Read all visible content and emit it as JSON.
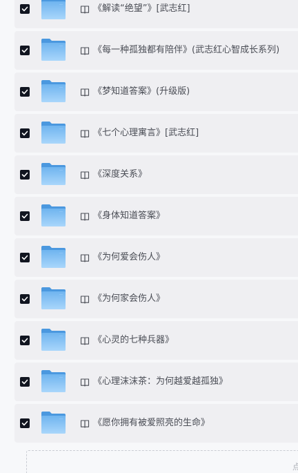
{
  "folders": [
    {
      "title": "《解读“绝望”》[武志红]",
      "checked": true
    },
    {
      "title": "《每一种孤独都有陪伴》(武志红心智成长系列)",
      "checked": true
    },
    {
      "title": "《梦知道答案》(升级版)",
      "checked": true
    },
    {
      "title": "《七个心理寓言》[武志红]",
      "checked": true
    },
    {
      "title": "《深度关系》",
      "checked": true
    },
    {
      "title": "《身体知道答案》",
      "checked": true
    },
    {
      "title": "《为何爱会伤人》",
      "checked": true
    },
    {
      "title": "《为何家会伤人》",
      "checked": true
    },
    {
      "title": "《心灵的七种兵器》",
      "checked": true
    },
    {
      "title": "《心理沫沫茶：为何越爱越孤独》",
      "checked": true
    },
    {
      "title": "《愿你拥有被爱照亮的生命》",
      "checked": true
    }
  ],
  "icons": {
    "checkbox": "checkbox-checked-icon",
    "folder": "folder-icon",
    "item": "book-icon"
  },
  "colors": {
    "checkbox": "#111520",
    "folder_top": "#6fb4ef",
    "folder_bottom": "#a9d6fb",
    "row_bg": "#efeff2"
  },
  "upload": {
    "hint": "点"
  }
}
